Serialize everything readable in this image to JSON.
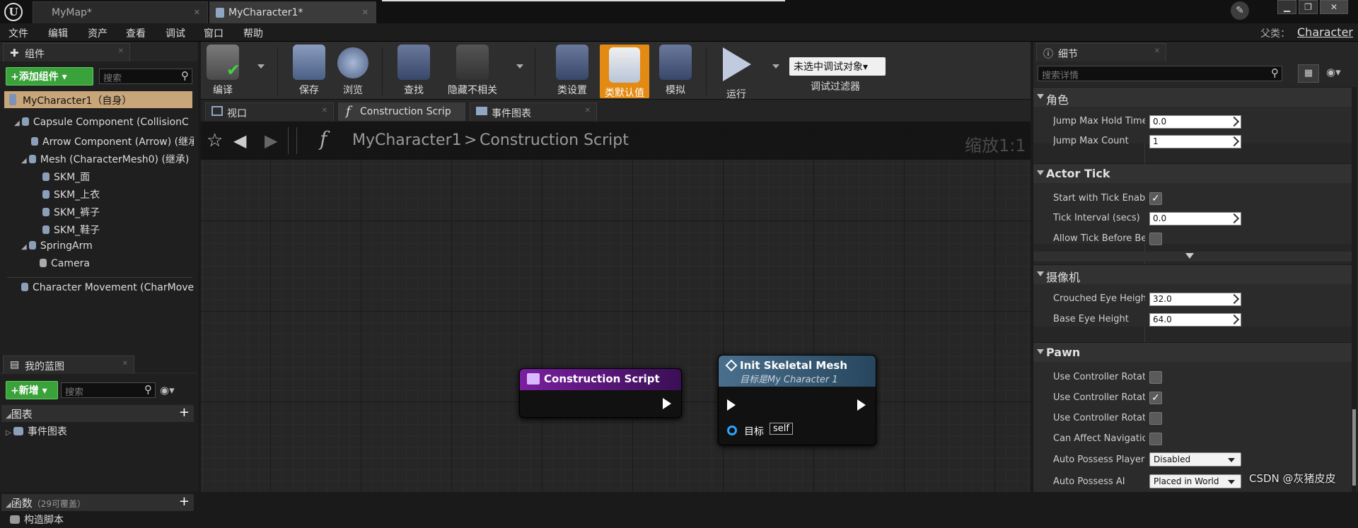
{
  "titlebar": {
    "tabs": [
      {
        "label": "MyMap*"
      },
      {
        "label": "MyCharacter1*"
      }
    ],
    "window_buttons": [
      "▁",
      "❐",
      "✕"
    ]
  },
  "menubar": {
    "items": [
      "文件",
      "编辑",
      "资产",
      "查看",
      "调试",
      "窗口",
      "帮助"
    ],
    "parent_label": "父类：",
    "parent_value": "Character"
  },
  "components_panel": {
    "tab_label": "组件",
    "add_button": "+添加组件 ▾",
    "search_placeholder": "搜索",
    "root": "MyCharacter1（自身）",
    "tree": [
      "Capsule Component (CollisionC",
      "Arrow Component (Arrow) (继承",
      "Mesh (CharacterMesh0) (继承)",
      "SKM_面",
      "SKM_上衣",
      "SKM_裤子",
      "SKM_鞋子",
      "SpringArm",
      "Camera",
      "Character Movement (CharMove"
    ]
  },
  "my_blueprint": {
    "tab_label": "我的蓝图",
    "new_button": "+新增 ▾",
    "search_placeholder": "搜索",
    "graphs_label": "图表",
    "event_graph": "事件图表",
    "functions_label": "函数",
    "functions_count": "（29可覆盖）",
    "construction_script": "构造脚本"
  },
  "toolbar": {
    "buttons": [
      "编译",
      "保存",
      "浏览",
      "查找",
      "隐藏不相关",
      "类设置",
      "类默认值",
      "模拟",
      "运行"
    ],
    "debug_dropdown": "未选中调试对象▾",
    "debug_filter": "调试过滤器"
  },
  "graph_tabs": [
    {
      "label": "视口"
    },
    {
      "label": "Construction Scrip"
    },
    {
      "label": "事件图表"
    }
  ],
  "breadcrumb": {
    "blueprint": "MyCharacter1",
    "separator": ">",
    "graph": "Construction Script",
    "zoom": "缩放1:1"
  },
  "nodes": {
    "construction": {
      "title": "Construction Script"
    },
    "init_mesh": {
      "title": "Init Skeletal Mesh",
      "subtitle": "目标是My Character 1",
      "pin_label": "目标",
      "pin_value": "self"
    }
  },
  "details": {
    "tab_label": "细节",
    "search_placeholder": "搜索详情",
    "categories": [
      {
        "name": "角色",
        "props": [
          {
            "label": "Jump Max Hold Time",
            "type": "number",
            "value": "0.0"
          },
          {
            "label": "Jump Max Count",
            "type": "number",
            "value": "1"
          }
        ]
      },
      {
        "name": "Actor Tick",
        "props": [
          {
            "label": "Start with Tick Enabled",
            "type": "check",
            "value": "✓"
          },
          {
            "label": "Tick Interval (secs)",
            "type": "number",
            "value": "0.0"
          },
          {
            "label": "Allow Tick Before Begin Play",
            "type": "check",
            "value": ""
          }
        ]
      },
      {
        "name": "摄像机",
        "props": [
          {
            "label": "Crouched Eye Height",
            "type": "number",
            "value": "32.0"
          },
          {
            "label": "Base Eye Height",
            "type": "number",
            "value": "64.0"
          }
        ]
      },
      {
        "name": "Pawn",
        "props": [
          {
            "label": "Use Controller Rotation Pitch",
            "type": "check",
            "value": ""
          },
          {
            "label": "Use Controller Rotation Yaw",
            "type": "check",
            "value": "✓"
          },
          {
            "label": "Use Controller Rotation Roll",
            "type": "check",
            "value": ""
          },
          {
            "label": "Can Affect Navigation Generation",
            "type": "check",
            "value": ""
          },
          {
            "label": "Auto Possess Player",
            "type": "dropdown",
            "value": "Disabled"
          },
          {
            "label": "Auto Possess AI",
            "type": "dropdown",
            "value": "Placed in World"
          }
        ]
      }
    ]
  },
  "watermark": "CSDN @灰猪皮皮",
  "colors": {
    "accent_orange": "#e28a12",
    "green_button": "#3aa23a",
    "construction_node": "#7a1fa0",
    "function_node": "#3e5f78",
    "root_item": "#c9a57a"
  }
}
